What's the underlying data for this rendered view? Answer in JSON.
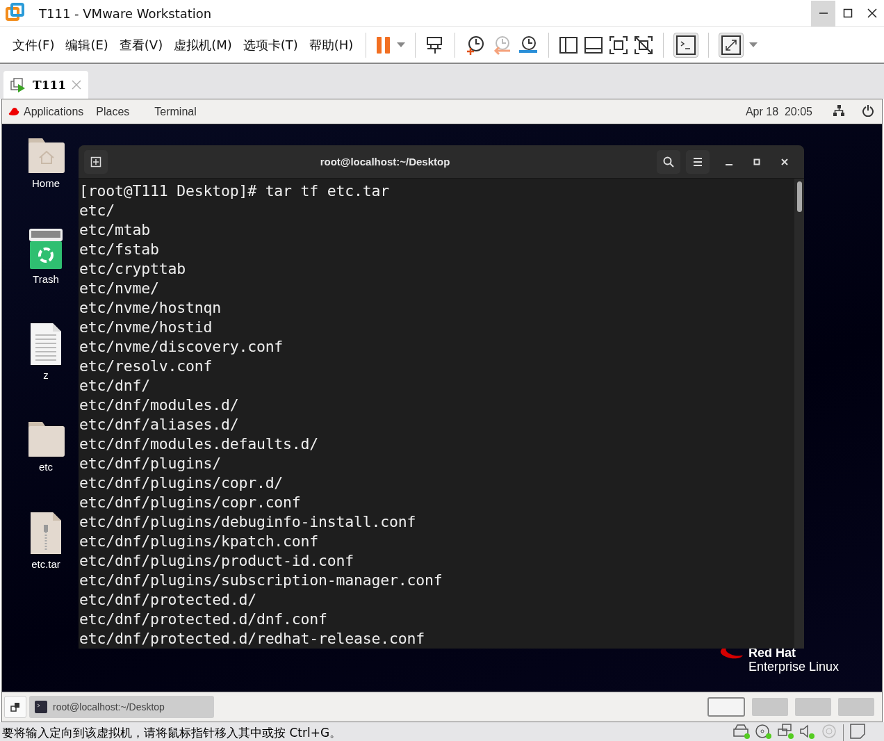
{
  "window": {
    "title": "T111 - VMware Workstation"
  },
  "menu": [
    "文件(F)",
    "编辑(E)",
    "查看(V)",
    "虚拟机(M)",
    "选项卡(T)",
    "帮助(H)"
  ],
  "tabs": [
    {
      "label": "T111",
      "selected": true
    }
  ],
  "top_bar": {
    "applications": "Applications",
    "places": "Places",
    "app": "Terminal",
    "clock": "Apr 18  20:05"
  },
  "desktop_icons": [
    {
      "label": "Home",
      "kind": "home"
    },
    {
      "label": "Trash",
      "kind": "trash"
    },
    {
      "label": "z",
      "kind": "document"
    },
    {
      "label": "etc",
      "kind": "folder"
    },
    {
      "label": "etc.tar",
      "kind": "archive"
    }
  ],
  "logo": {
    "line1": "Red Hat",
    "line2": "Enterprise Linux"
  },
  "terminal": {
    "title": "root@localhost:~/Desktop",
    "lines": [
      "[root@T111 Desktop]# tar tf etc.tar",
      "etc/",
      "etc/mtab",
      "etc/fstab",
      "etc/crypttab",
      "etc/nvme/",
      "etc/nvme/hostnqn",
      "etc/nvme/hostid",
      "etc/nvme/discovery.conf",
      "etc/resolv.conf",
      "etc/dnf/",
      "etc/dnf/modules.d/",
      "etc/dnf/aliases.d/",
      "etc/dnf/modules.defaults.d/",
      "etc/dnf/plugins/",
      "etc/dnf/plugins/copr.d/",
      "etc/dnf/plugins/copr.conf",
      "etc/dnf/plugins/debuginfo-install.conf",
      "etc/dnf/plugins/kpatch.conf",
      "etc/dnf/plugins/product-id.conf",
      "etc/dnf/plugins/subscription-manager.conf",
      "etc/dnf/protected.d/",
      "etc/dnf/protected.d/dnf.conf",
      "etc/dnf/protected.d/redhat-release.conf"
    ]
  },
  "taskbar": {
    "task": "root@localhost:~/Desktop",
    "workspaces": [
      {
        "selected": true
      },
      {
        "selected": false
      },
      {
        "selected": false
      },
      {
        "selected": false
      }
    ]
  },
  "status_bar": {
    "message": "要将输入定向到该虚拟机，请将鼠标指针移入其中或按 Ctrl+G。"
  }
}
